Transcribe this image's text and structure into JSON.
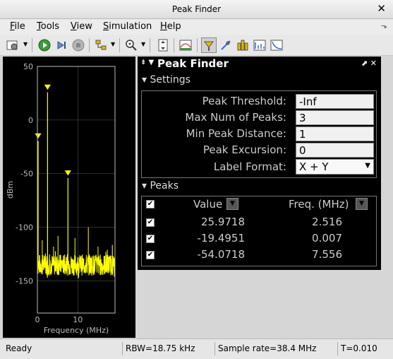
{
  "window": {
    "title": "Peak Finder"
  },
  "menu": {
    "items": [
      {
        "key": "F",
        "rest": "ile"
      },
      {
        "key": "T",
        "rest": "ools"
      },
      {
        "key": "V",
        "rest": "iew"
      },
      {
        "key": "S",
        "rest": "imulation"
      },
      {
        "key": "H",
        "rest": "elp"
      }
    ]
  },
  "colors": {
    "trace": "#ffff00",
    "plot_bg": "#000000",
    "axis": "#bbbbbb",
    "grid": "#5a5a5a",
    "marker": "#ffff00"
  },
  "chart_data": {
    "type": "line",
    "xlabel": "Frequency (MHz)",
    "ylabel": "dBm",
    "xlim": [
      0,
      19.2
    ],
    "ylim": [
      -180,
      50
    ],
    "xticks": [
      "0",
      "10"
    ],
    "yticks": [
      "50",
      "0",
      "-50",
      "-100",
      "-150"
    ],
    "noise_floor": -135,
    "grid": true,
    "peaks": [
      {
        "freq": 2.516,
        "value": 25.9718
      },
      {
        "freq": 0.007,
        "value": -19.4951
      },
      {
        "freq": 7.556,
        "value": -54.0718
      }
    ],
    "series": [
      {
        "x": [
          0.0,
          0.6,
          1.2,
          1.8,
          2.516,
          3.0,
          3.6,
          4.2,
          4.8,
          5.4,
          6.0,
          6.6,
          7.2,
          7.556,
          8.2,
          8.8,
          9.4,
          10.0,
          10.6,
          11.2,
          11.8,
          12.4,
          13.0,
          13.6,
          14.2,
          14.8,
          15.4,
          16.0,
          16.6,
          17.2,
          17.8,
          18.4,
          19.2
        ],
        "y": [
          -19.5,
          -132,
          -128,
          -135,
          25.97,
          -131,
          -137,
          -130,
          -126,
          -138,
          -133,
          -129,
          -136,
          -54.07,
          -131,
          -135,
          -127,
          -133,
          -137,
          -130,
          -129,
          -136,
          -132,
          -128,
          -135,
          -131,
          -137,
          -129,
          -133,
          -136,
          -130,
          -132,
          -134
        ]
      }
    ],
    "spurs": [
      {
        "freq": 1.2,
        "value": -112
      },
      {
        "freq": 4.0,
        "value": -118
      },
      {
        "freq": 5.1,
        "value": -108
      },
      {
        "freq": 9.3,
        "value": -110
      },
      {
        "freq": 12.6,
        "value": -100
      },
      {
        "freq": 15.0,
        "value": -118
      },
      {
        "freq": 17.3,
        "value": -121
      }
    ]
  },
  "peak_finder": {
    "title": "Peak Finder",
    "settings_label": "Settings",
    "params": [
      {
        "label": "Peak Threshold:",
        "value": "-Inf"
      },
      {
        "label": "Max Num of Peaks:",
        "value": "3"
      },
      {
        "label": "Min Peak Distance:",
        "value": "1"
      },
      {
        "label": "Peak Excursion:",
        "value": "0"
      }
    ],
    "label_format": {
      "label": "Label Format:",
      "value": "X + Y"
    },
    "peaks_label": "Peaks",
    "columns": {
      "value": "Value",
      "freq": "Freq. (MHz)"
    },
    "rows": [
      {
        "value": "25.9718",
        "freq": "2.516"
      },
      {
        "value": "-19.4951",
        "freq": "0.007"
      },
      {
        "value": "-54.0718",
        "freq": "7.556"
      }
    ]
  },
  "status": {
    "state": "Ready",
    "rbw": "RBW=18.75 kHz",
    "sample_rate": "Sample rate=38.4 MHz",
    "time": "T=0.010"
  }
}
